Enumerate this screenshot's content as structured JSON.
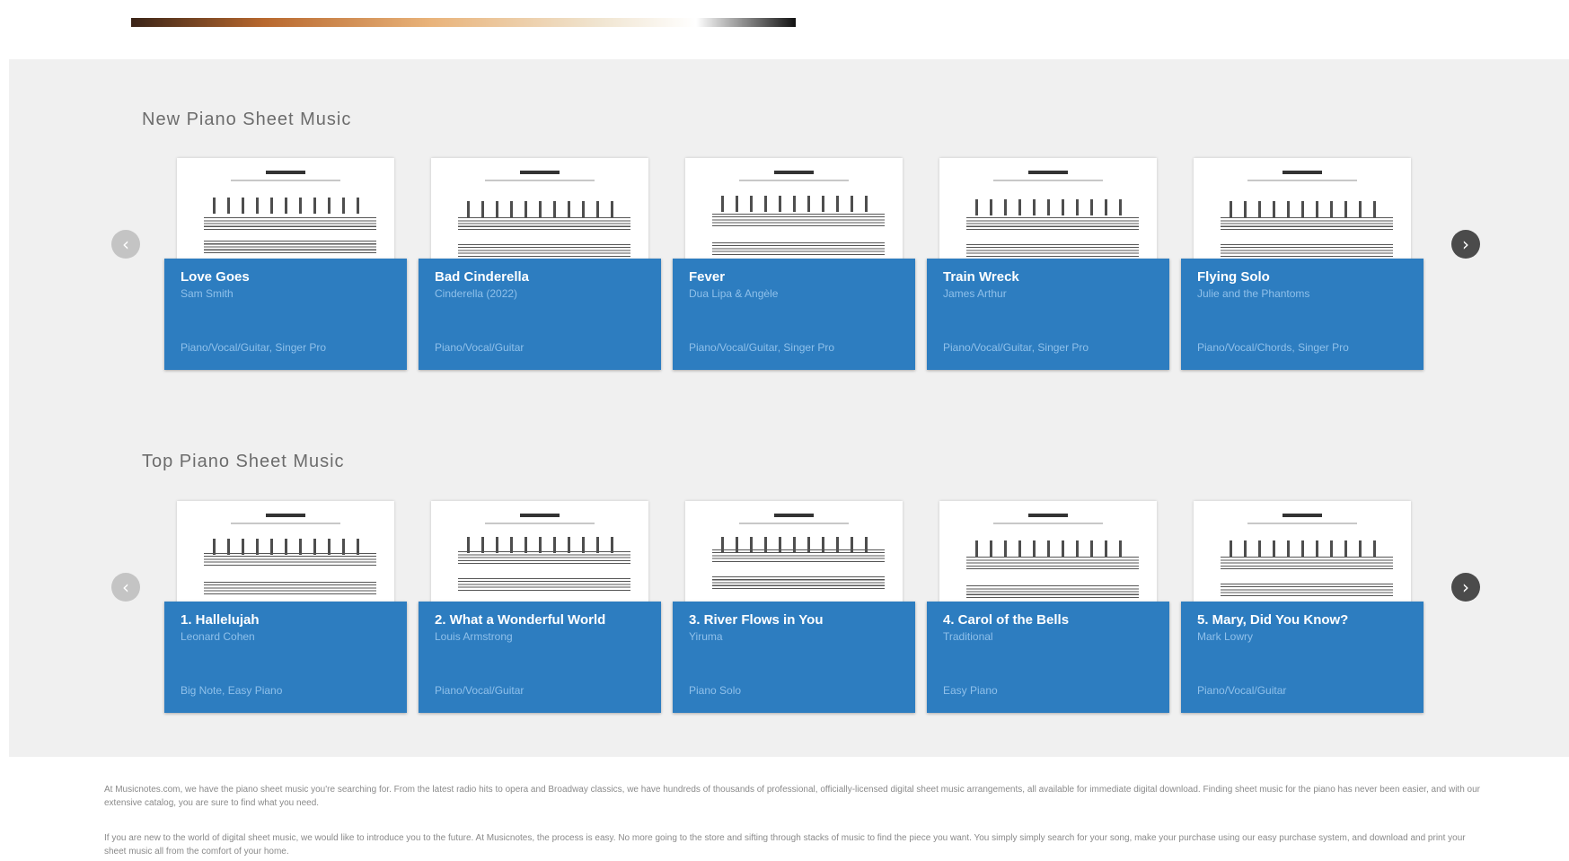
{
  "sections": [
    {
      "title": "New Piano Sheet Music",
      "items": [
        {
          "title": "Love Goes",
          "artist": "Sam Smith",
          "meta": "Piano/Vocal/Guitar, Singer Pro"
        },
        {
          "title": "Bad Cinderella",
          "artist": "Cinderella (2022)",
          "meta": "Piano/Vocal/Guitar"
        },
        {
          "title": "Fever",
          "artist": "Dua Lipa & Angèle",
          "meta": "Piano/Vocal/Guitar, Singer Pro"
        },
        {
          "title": "Train Wreck",
          "artist": "James Arthur",
          "meta": "Piano/Vocal/Guitar, Singer Pro"
        },
        {
          "title": "Flying Solo",
          "artist": "Julie and the Phantoms",
          "meta": "Piano/Vocal/Chords, Singer Pro"
        }
      ]
    },
    {
      "title": "Top Piano Sheet Music",
      "items": [
        {
          "title": "1. Hallelujah",
          "artist": "Leonard Cohen",
          "meta": "Big Note, Easy Piano"
        },
        {
          "title": "2. What a Wonderful World",
          "artist": "Louis Armstrong",
          "meta": "Piano/Vocal/Guitar"
        },
        {
          "title": "3. River Flows in You",
          "artist": "Yiruma",
          "meta": "Piano Solo"
        },
        {
          "title": "4. Carol of the Bells",
          "artist": "Traditional",
          "meta": "Easy Piano"
        },
        {
          "title": "5. Mary, Did You Know?",
          "artist": "Mark Lowry",
          "meta": "Piano/Vocal/Guitar"
        }
      ]
    }
  ],
  "nav": {
    "prev_glyph": "‹",
    "next_glyph": "›"
  },
  "footer_text": [
    "At Musicnotes.com, we have the piano sheet music you're searching for. From the latest radio hits to opera and Broadway classics, we have hundreds of thousands of professional, officially-licensed digital sheet music arrangements, all available for immediate digital download. Finding sheet music for the piano has never been easier, and with our extensive catalog, you are sure to find what you need.",
    "If you are new to the world of digital sheet music, we would like to introduce you to the future. At Musicnotes, the process is easy. No more going to the store and sifting through stacks of music to find the piece you want. You simply simply search for your song, make your purchase using our easy purchase system, and download and print your sheet music all from the comfort of your home."
  ],
  "colors": {
    "card_panel": "#2d7dc0",
    "band_background": "#f0f0f0",
    "arrow_active": "#4b4b4b",
    "arrow_inactive": "#c4c4c4"
  }
}
